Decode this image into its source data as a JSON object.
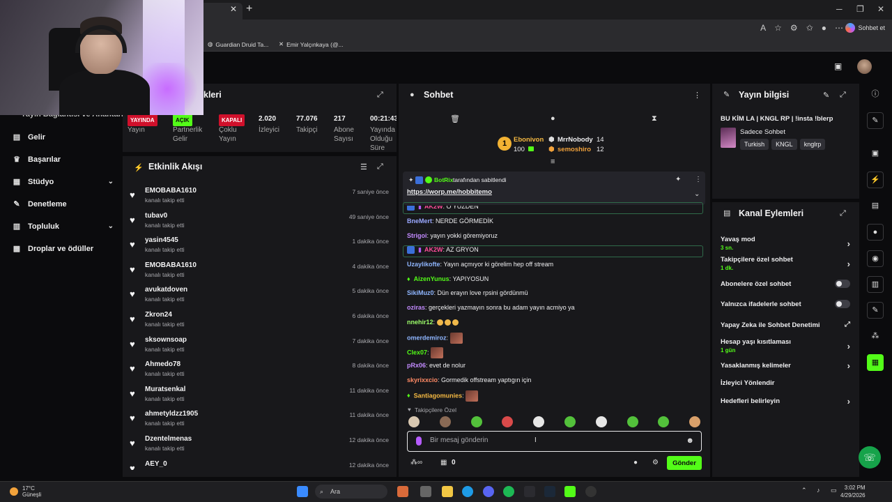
{
  "browser": {
    "tabs": [
      {
        "label": "Guardian Druid Ta..."
      },
      {
        "label": "Emir Yalçınkaya (@..."
      }
    ],
    "new_tab": "+",
    "close": "✕",
    "copilot_label": "Sohbet et"
  },
  "sidebar": {
    "partial_title": "Yayın Bağlantısı ve Anahtarı",
    "items": [
      {
        "label": "Gelir",
        "icon": "dollar-icon"
      },
      {
        "label": "Başarılar",
        "icon": "trophy-icon"
      },
      {
        "label": "Stüdyo",
        "icon": "studio-icon",
        "expandable": true
      },
      {
        "label": "Denetleme",
        "icon": "wrench-icon"
      },
      {
        "label": "Topluluk",
        "icon": "community-icon",
        "expandable": true
      },
      {
        "label": "Droplar ve ödüller",
        "icon": "gift-icon"
      }
    ]
  },
  "stats_panel": {
    "title_partial": "kleri",
    "stats": [
      {
        "badge": "YAYINDA",
        "badge_color": "#d0102b",
        "label": "Yayın"
      },
      {
        "badge": "AÇIK",
        "badge_color": "#53fc18",
        "label": "Partnerlik Gelir"
      },
      {
        "badge": "KAPALI",
        "badge_color": "#d0102b",
        "label": "Çoklu Yayın"
      },
      {
        "value": "2.020",
        "label": "İzleyici"
      },
      {
        "value": "77.076",
        "label": "Takipçi"
      },
      {
        "value": "217",
        "label": "Abone Sayısı"
      },
      {
        "value": "00:21:43",
        "label": "Yayında Olduğu Süre"
      }
    ]
  },
  "activity_feed": {
    "title": "Etkinlik Akışı",
    "events": [
      {
        "name": "EMOBABA1610",
        "action": "kanalı takip etti",
        "time": "7 saniye önce"
      },
      {
        "name": "tubav0",
        "action": "kanalı takip etti",
        "time": "49 saniye önce"
      },
      {
        "name": "yasin4545",
        "action": "kanalı takip etti",
        "time": "1 dakika önce"
      },
      {
        "name": "EMOBABA1610",
        "action": "kanalı takip etti",
        "time": "4 dakika önce"
      },
      {
        "name": "avukatdoven",
        "action": "kanalı takip etti",
        "time": "5 dakika önce"
      },
      {
        "name": "Zkron24",
        "action": "kanalı takip etti",
        "time": "6 dakika önce"
      },
      {
        "name": "sksownsoap",
        "action": "kanalı takip etti",
        "time": "7 dakika önce"
      },
      {
        "name": "Ahmedo78",
        "action": "kanalı takip etti",
        "time": "8 dakika önce"
      },
      {
        "name": "Muratsenkal",
        "action": "kanalı takip etti",
        "time": "11 dakika önce"
      },
      {
        "name": "ahmetyldzz1905",
        "action": "kanalı takip etti",
        "time": "11 dakika önce"
      },
      {
        "name": "Dzentelmenas",
        "action": "kanalı takip etti",
        "time": "12 dakika önce"
      },
      {
        "name": "AEY_0",
        "action": "kanalı takip etti",
        "time": "12 dakika önce"
      }
    ]
  },
  "chat": {
    "title": "Sohbet",
    "leaderboard": {
      "rank": "1",
      "top": {
        "name": "Ebonivon",
        "count": "100"
      },
      "second": {
        "name": "MrrNobody",
        "count": "14"
      },
      "third": {
        "name": "semoshiro",
        "count": "12"
      }
    },
    "pinned": {
      "by_user": "BotRix",
      "by_text": "tarafından sabitlendi",
      "link": "https://worp.me/hobbitemo"
    },
    "messages": [
      {
        "user": "AK2W",
        "text": ": O YÜZDEN",
        "color": "#ff4d9a",
        "highlight": true
      },
      {
        "user": "BneMert",
        "text": ": NERDE GÖRMEDİK",
        "color": "#9aa8ff"
      },
      {
        "user": "Strigoi",
        "text": ": yayın yokki göremiyoruz",
        "color": "#c38bff"
      },
      {
        "user": "AK2W",
        "text": ": AZ GRYON",
        "color": "#ff4d9a",
        "highlight": true
      },
      {
        "user": "Uzaylikofte",
        "text": ": Yayın açmıyor ki görelim hep off stream",
        "color": "#8fb6ff"
      },
      {
        "user": "AizenYunus",
        "text": ": YAPIYOSUN",
        "color": "#53fc18"
      },
      {
        "user": "SikiMuz0",
        "text": ": Dün erayın love rpsini gördünmü",
        "color": "#8fb6ff"
      },
      {
        "user": "oziras",
        "text": ": gerçekleri yazmayın sonra bu adam yayın acmiyo ya",
        "color": "#c38bff"
      },
      {
        "user": "nnehir12",
        "text": ":",
        "color": "#9dff6a",
        "smiles": true
      },
      {
        "user": "omerdemiroz",
        "text": ":",
        "color": "#8fb6ff",
        "emote": true
      },
      {
        "user": "Clex07",
        "text": ":",
        "color": "#53fc18",
        "emote": true
      },
      {
        "user": "pRx06",
        "text": ": evet de nolur",
        "color": "#c38bff"
      },
      {
        "user": "skyrixxcio",
        "text": ": Gormedik offstream yaptıgın için",
        "color": "#ff8a65"
      },
      {
        "user": "Santiagomunies",
        "text": ":",
        "color": "#f5b942",
        "emote": true
      }
    ],
    "followers_only_label": "Takipçilere Özel",
    "input_placeholder": "Bir mesaj gönderin",
    "points_count": "0",
    "send_label": "Gönder"
  },
  "stream_info": {
    "title": "Yayın bilgisi",
    "stream_title": "BU KİM LA | KNGL RP | !insta !blerp",
    "category": "Sadece Sohbet",
    "tags": [
      "Turkish",
      "KNGL",
      "knglrp"
    ]
  },
  "channel_actions": {
    "title": "Kanal Eylemleri",
    "items": [
      {
        "label": "Yavaş mod",
        "sub": "3 sn.",
        "control": "arrow"
      },
      {
        "label": "Takipçilere özel sohbet",
        "sub": "1 dk.",
        "control": "arrow"
      },
      {
        "label": "Abonelere özel sohbet",
        "control": "toggle"
      },
      {
        "label": "Yalnızca ifadelerle sohbet",
        "control": "toggle"
      },
      {
        "label": "Yapay Zeka ile Sohbet Denetimi",
        "control": "external"
      },
      {
        "label": "Hesap yaşı kısıtlaması",
        "sub": "1 gün",
        "control": "arrow"
      },
      {
        "label": "Yasaklanmış kelimeler",
        "control": "arrow"
      },
      {
        "label": "İzleyici Yönlendir",
        "control": "none"
      },
      {
        "label": "Hedefleri belirleyin",
        "control": "arrow"
      }
    ]
  },
  "taskbar": {
    "weather_temp": "17°C",
    "weather_desc": "Güneşli",
    "search_placeholder": "Ara",
    "time": "3:02 PM",
    "date": "4/29/2026"
  },
  "colors": {
    "accent": "#53fc18",
    "live_red": "#d0102b",
    "panel_bg": "#18181b"
  }
}
